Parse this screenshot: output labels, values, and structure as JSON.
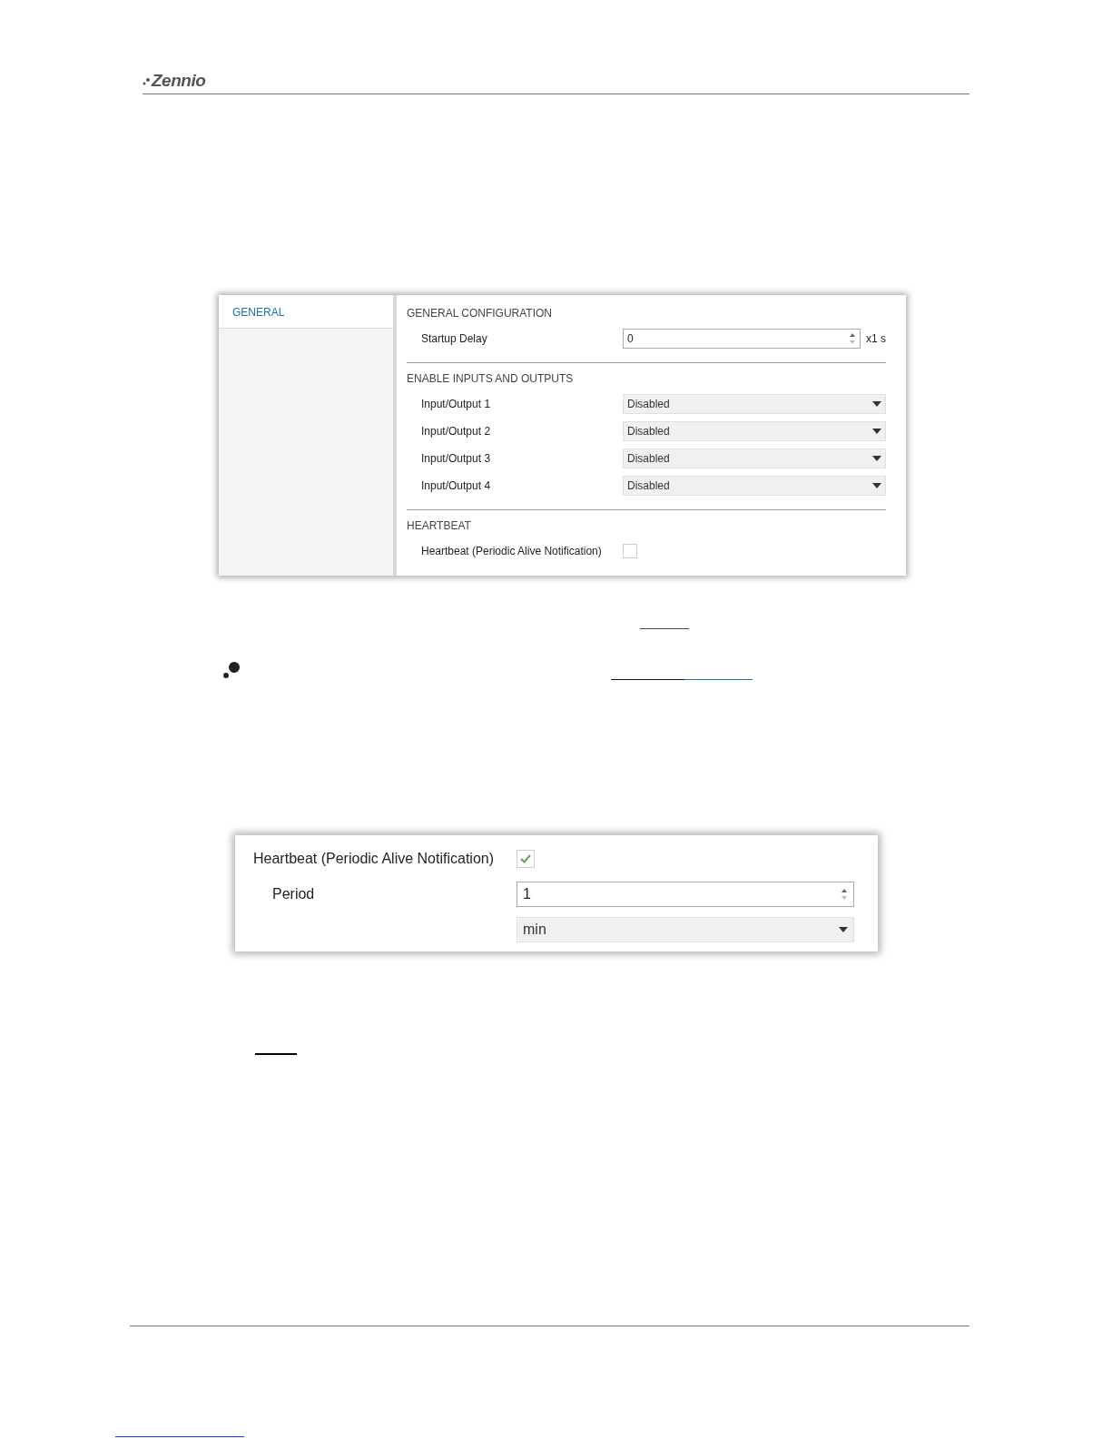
{
  "header": {
    "logo": "Zennio"
  },
  "general_window": {
    "tabs": [
      {
        "label": "GENERAL",
        "selected": true
      }
    ],
    "sections": [
      {
        "title": "GENERAL CONFIGURATION",
        "params": [
          {
            "kind": "spin",
            "label": "Startup Delay",
            "value": "0",
            "unit": "x1 s"
          }
        ]
      },
      {
        "title": "ENABLE INPUTS AND OUTPUTS",
        "params": [
          {
            "kind": "select",
            "label": "Input/Output 1",
            "value": "Disabled"
          },
          {
            "kind": "select",
            "label": "Input/Output 2",
            "value": "Disabled"
          },
          {
            "kind": "select",
            "label": "Input/Output 3",
            "value": "Disabled"
          },
          {
            "kind": "select",
            "label": "Input/Output 4",
            "value": "Disabled"
          }
        ]
      },
      {
        "title": "HEARTBEAT",
        "params": [
          {
            "kind": "checkbox",
            "label": "Heartbeat (Periodic Alive Notification)",
            "checked": false
          }
        ]
      }
    ]
  },
  "heartbeat_window": {
    "params": [
      {
        "kind": "checkbox",
        "label": "Heartbeat (Periodic Alive Notification)",
        "checked": true,
        "children": [
          {
            "kind": "spin",
            "label": "Period",
            "value": "1"
          },
          {
            "kind": "select",
            "value": "min"
          }
        ]
      }
    ]
  }
}
